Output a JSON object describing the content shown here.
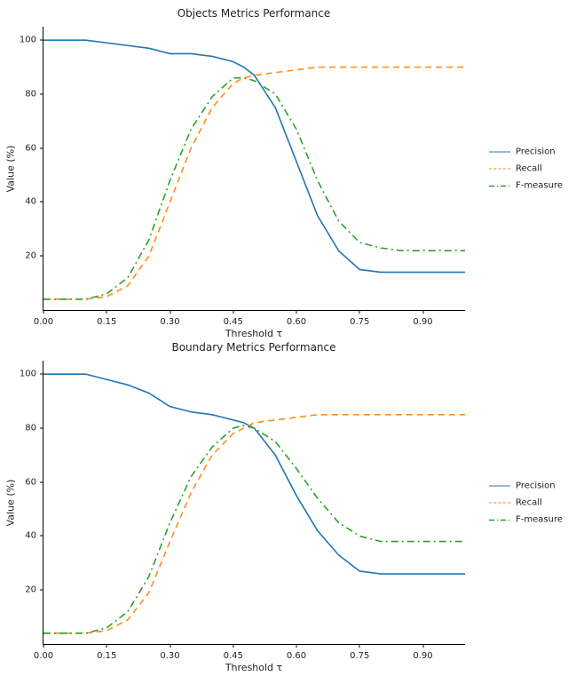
{
  "colors": {
    "precision": "#1f77b4",
    "recall": "#ff8c1a",
    "fmeasure": "#2ca02c"
  },
  "chart_data": [
    {
      "type": "line",
      "title": "Objects Metrics Performance",
      "xlabel": "Threshold τ",
      "ylabel": "Value (%)",
      "xlim": [
        0.0,
        1.0
      ],
      "ylim": [
        0,
        105
      ],
      "xticks": [
        0.0,
        0.15,
        0.3,
        0.45,
        0.6,
        0.75,
        0.9
      ],
      "yticks": [
        20,
        40,
        60,
        80,
        100
      ],
      "x": [
        0.0,
        0.05,
        0.1,
        0.15,
        0.2,
        0.25,
        0.3,
        0.35,
        0.4,
        0.45,
        0.475,
        0.5,
        0.55,
        0.6,
        0.65,
        0.7,
        0.75,
        0.8,
        0.85,
        0.9,
        0.95,
        1.0
      ],
      "legend_position": "right",
      "series": [
        {
          "name": "Precision",
          "style": "solid",
          "color_key": "precision",
          "values": [
            100,
            100,
            100,
            99,
            98,
            97,
            95,
            95,
            94,
            92,
            90,
            87,
            75,
            55,
            35,
            22,
            15,
            14,
            14,
            14,
            14,
            14
          ]
        },
        {
          "name": "Recall",
          "style": "dashed",
          "color_key": "recall",
          "values": [
            4,
            4,
            4,
            5,
            9,
            20,
            40,
            60,
            75,
            84,
            86,
            87,
            88,
            89,
            90,
            90,
            90,
            90,
            90,
            90,
            90,
            90
          ]
        },
        {
          "name": "F-measure",
          "style": "dashdot",
          "color_key": "fmeasure",
          "values": [
            4,
            4,
            4,
            6,
            12,
            26,
            48,
            67,
            79,
            86,
            86,
            85,
            80,
            67,
            48,
            33,
            25,
            23,
            22,
            22,
            22,
            22
          ]
        }
      ]
    },
    {
      "type": "line",
      "title": "Boundary Metrics Performance",
      "xlabel": "Threshold τ",
      "ylabel": "Value (%)",
      "xlim": [
        0.0,
        1.0
      ],
      "ylim": [
        0,
        105
      ],
      "xticks": [
        0.0,
        0.15,
        0.3,
        0.45,
        0.6,
        0.75,
        0.9
      ],
      "yticks": [
        20,
        40,
        60,
        80,
        100
      ],
      "x": [
        0.0,
        0.05,
        0.1,
        0.15,
        0.2,
        0.25,
        0.3,
        0.35,
        0.4,
        0.45,
        0.475,
        0.5,
        0.55,
        0.6,
        0.65,
        0.7,
        0.75,
        0.8,
        0.85,
        0.9,
        0.95,
        1.0
      ],
      "legend_position": "right",
      "series": [
        {
          "name": "Precision",
          "style": "solid",
          "color_key": "precision",
          "values": [
            100,
            100,
            100,
            98,
            96,
            93,
            88,
            86,
            85,
            83,
            82,
            80,
            70,
            55,
            42,
            33,
            27,
            26,
            26,
            26,
            26,
            26
          ]
        },
        {
          "name": "Recall",
          "style": "dashed",
          "color_key": "recall",
          "values": [
            4,
            4,
            4,
            5,
            9,
            19,
            38,
            56,
            70,
            78,
            80,
            82,
            83,
            84,
            85,
            85,
            85,
            85,
            85,
            85,
            85,
            85
          ]
        },
        {
          "name": "F-measure",
          "style": "dashdot",
          "color_key": "fmeasure",
          "values": [
            4,
            4,
            4,
            6,
            12,
            25,
            45,
            62,
            73,
            80,
            81,
            80,
            75,
            65,
            54,
            45,
            40,
            38,
            38,
            38,
            38,
            38
          ]
        }
      ]
    }
  ]
}
